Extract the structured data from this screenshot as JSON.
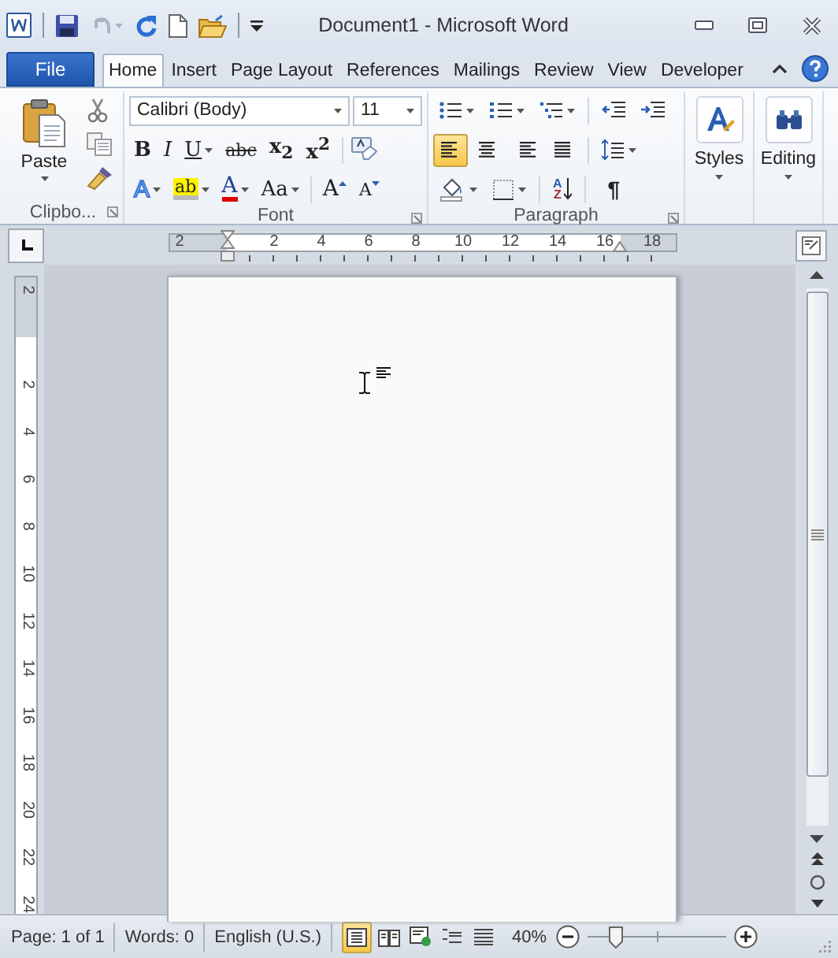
{
  "window": {
    "title": "Document1  -  Microsoft Word"
  },
  "quick_access": {
    "undo": {
      "disabled": true
    }
  },
  "file_tab": {
    "label": "File"
  },
  "tabs": [
    {
      "label": "Home",
      "selected": true
    },
    {
      "label": "Insert",
      "selected": false
    },
    {
      "label": "Page Layout",
      "selected": false
    },
    {
      "label": "References",
      "selected": false
    },
    {
      "label": "Mailings",
      "selected": false
    },
    {
      "label": "Review",
      "selected": false
    },
    {
      "label": "View",
      "selected": false
    },
    {
      "label": "Developer",
      "selected": false
    }
  ],
  "ribbon": {
    "clipboard": {
      "label": "Clipbo...",
      "paste": "Paste"
    },
    "font": {
      "label": "Font",
      "font_name": "Calibri (Body)",
      "font_size": "11",
      "format_buttons": [
        {
          "kind": "bold",
          "label": "B",
          "dropdown": false
        },
        {
          "kind": "italic",
          "label": "I",
          "dropdown": false
        },
        {
          "kind": "underline",
          "label": "U",
          "dropdown": true
        },
        {
          "kind": "strike",
          "label": "abc",
          "dropdown": false
        },
        {
          "kind": "subscript",
          "label": "x$_{2}$",
          "dropdown": false
        },
        {
          "kind": "superscript",
          "label": "x$^{2}$",
          "dropdown": false
        }
      ],
      "effect_buttons": [
        {
          "kind": "effects",
          "label": "A",
          "dropdown": true
        },
        {
          "kind": "highlight",
          "label": "ab",
          "dropdown": true
        },
        {
          "kind": "color",
          "label": "A",
          "dropdown": true
        },
        {
          "kind": "case",
          "label": "Aa",
          "dropdown": true
        },
        {
          "kind": "grow",
          "label": "A",
          "dropdown": false
        },
        {
          "kind": "shrink",
          "label": "A",
          "dropdown": false
        }
      ]
    },
    "paragraph": {
      "label": "Paragraph",
      "alignment": [
        {
          "selected": true
        },
        {
          "selected": false
        },
        {
          "selected": false
        },
        {
          "selected": false
        }
      ],
      "sort": {
        "top": "A",
        "bottom": "Z"
      },
      "pilcrow": "¶"
    },
    "styles": {
      "label": "Styles"
    },
    "editing": {
      "label": "Editing"
    }
  },
  "ruler": {
    "horizontal": [
      "2",
      "2",
      "4",
      "6",
      "8",
      "10",
      "12",
      "14",
      "16",
      "18"
    ],
    "vertical": [
      "2",
      "2",
      "4",
      "6",
      "8",
      "10",
      "12",
      "14",
      "16",
      "18",
      "20",
      "22",
      "24"
    ]
  },
  "status_bar": {
    "page": "Page: 1 of 1",
    "words": "Words: 0",
    "language": "English (U.S.)",
    "views": [
      {
        "selected": true
      },
      {
        "selected": false
      },
      {
        "selected": false
      },
      {
        "selected": false
      },
      {
        "selected": false
      }
    ],
    "zoom": "40%",
    "zoom_slider": {
      "level": 0.2
    }
  }
}
